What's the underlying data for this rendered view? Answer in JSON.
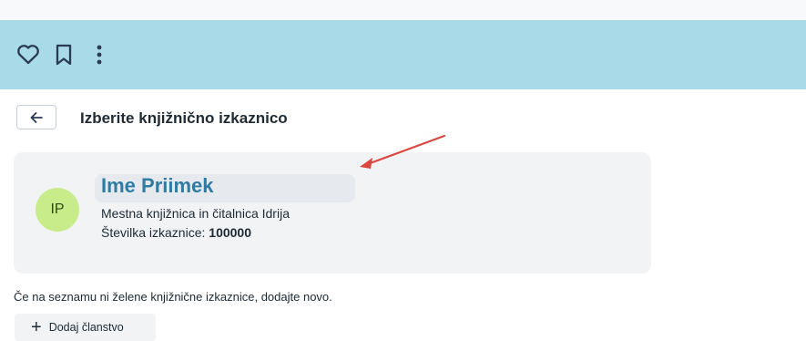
{
  "toolbar": {
    "icons": [
      "heart-icon",
      "bookmark-icon",
      "more-vertical-icon"
    ]
  },
  "header": {
    "back_icon": "arrow-left-icon",
    "title": "Izberite knjižnično izkaznico"
  },
  "card": {
    "avatar_initials": "IP",
    "name": "Ime Priimek",
    "library": "Mestna knjižnica in čitalnica Idrija",
    "card_number_label": "Številka izkaznice:",
    "card_number_value": "100000"
  },
  "hint": "Če na seznamu ni želene knjižnične izkaznice, dodajte novo.",
  "add_button": {
    "icon": "plus-icon",
    "label": "Dodaj članstvo"
  },
  "colors": {
    "toolbar_bg": "#a9dae8",
    "name_color": "#2e7ca3",
    "avatar_bg": "#c8ec8a",
    "annotation_arrow": "#d9473f"
  }
}
